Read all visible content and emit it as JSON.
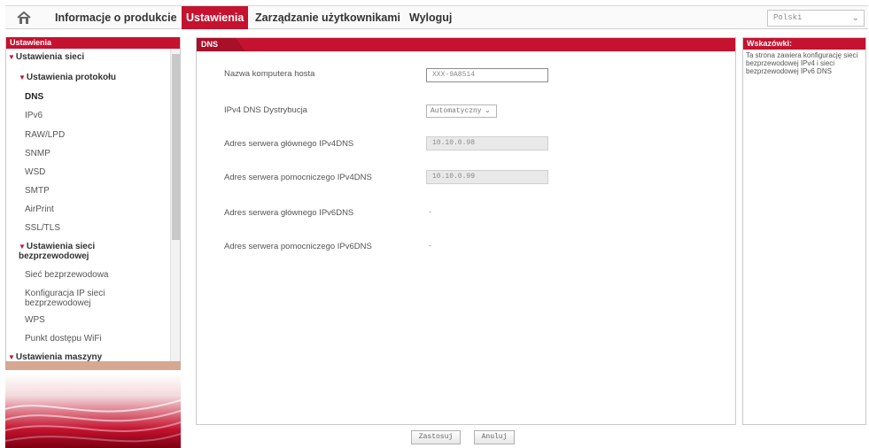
{
  "nav": {
    "items": [
      {
        "label": "Informacje o produkcie",
        "active": false
      },
      {
        "label": "Ustawienia",
        "active": true
      },
      {
        "label": "Zarządzanie użytkownikami",
        "active": false
      },
      {
        "label": "Wyloguj",
        "active": false
      }
    ],
    "language": "Polski"
  },
  "sidebar": {
    "title": "Ustawienia",
    "items": [
      {
        "label": "Ustawienia sieci",
        "type": "category"
      },
      {
        "label": "Ustawienia protokołu",
        "type": "category"
      },
      {
        "label": "DNS",
        "type": "current"
      },
      {
        "label": "IPv6",
        "type": "item"
      },
      {
        "label": "RAW/LPD",
        "type": "item"
      },
      {
        "label": "SNMP",
        "type": "item"
      },
      {
        "label": "WSD",
        "type": "item"
      },
      {
        "label": "SMTP",
        "type": "item"
      },
      {
        "label": "AirPrint",
        "type": "item"
      },
      {
        "label": "SSL/TLS",
        "type": "item"
      },
      {
        "label": "Ustawienia sieci bezprzewodowej",
        "type": "category"
      },
      {
        "label": "Sieć bezprzewodowa",
        "type": "item"
      },
      {
        "label": "Konfiguracja IP sieci bezprzewodowej",
        "type": "item"
      },
      {
        "label": "WPS",
        "type": "item"
      },
      {
        "label": "Punkt dostępu WiFi",
        "type": "item"
      },
      {
        "label": "Ustawienia maszyny",
        "type": "category"
      }
    ]
  },
  "main": {
    "title": "DNS",
    "fields": [
      {
        "label": "Nazwa komputera hosta",
        "value": "XXX-9A8514",
        "kind": "input"
      },
      {
        "label": "IPv4 DNS Dystrybucja",
        "value": "Automatyczny",
        "kind": "select"
      },
      {
        "label": "Adres serwera głównego IPv4DNS",
        "value": "10.10.0.98",
        "kind": "readonly"
      },
      {
        "label": "Adres serwera pomocniczego IPv4DNS",
        "value": "10.10.0.99",
        "kind": "readonly"
      },
      {
        "label": "Adres serwera głównego IPv6DNS",
        "value": "-",
        "kind": "text"
      },
      {
        "label": "Adres serwera pomocniczego IPv6DNS",
        "value": "-",
        "kind": "text"
      }
    ]
  },
  "buttons": {
    "apply": "Zastosuj",
    "cancel": "Anuluj"
  },
  "hints": {
    "title": "Wskazówki:",
    "body": "Ta strona zawiera konfigurację sieci bezprzewodowej IPv4 i sieci bezprzewodowej IPv6 DNS"
  },
  "colors": {
    "accent": "#c4122f"
  }
}
